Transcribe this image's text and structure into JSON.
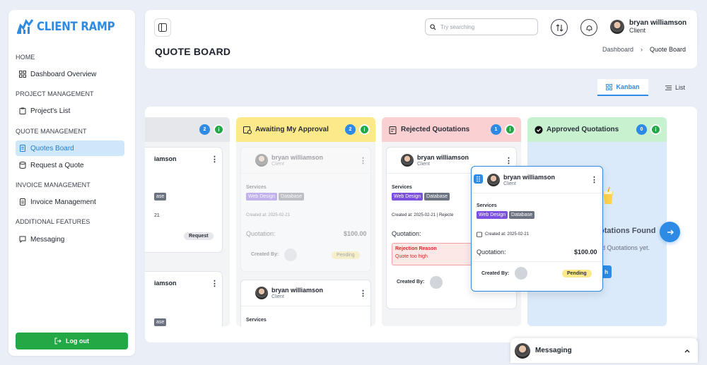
{
  "app": {
    "name": "CLIENT RAMP"
  },
  "sidebar": {
    "sections": [
      {
        "label": "HOME",
        "items": [
          {
            "label": "Dashboard Overview",
            "icon": "dashboard-icon"
          }
        ]
      },
      {
        "label": "PROJECT MANAGEMENT",
        "items": [
          {
            "label": "Project's List",
            "icon": "clipboard-icon"
          }
        ]
      },
      {
        "label": "QUOTE MANAGEMENT",
        "items": [
          {
            "label": "Quotes Board",
            "icon": "document-icon",
            "active": true
          },
          {
            "label": "Request a Quote",
            "icon": "database-icon"
          }
        ]
      },
      {
        "label": "INVOICE MANAGEMENT",
        "items": [
          {
            "label": "Invoice Management",
            "icon": "invoice-icon"
          }
        ]
      },
      {
        "label": "ADDITIONAL FEATURES",
        "items": [
          {
            "label": "Messaging",
            "icon": "chat-icon"
          }
        ]
      }
    ],
    "logout_label": "Log out"
  },
  "header": {
    "search_placeholder": "Try searching",
    "user": {
      "name": "bryan williamson",
      "role": "Client"
    }
  },
  "page": {
    "title": "QUOTE BOARD",
    "breadcrumb": [
      "Dashboard",
      "Quote Board"
    ]
  },
  "views": {
    "kanban": "Kanban",
    "list": "List",
    "active": "kanban"
  },
  "board": {
    "columns": [
      {
        "title": "",
        "count": "2",
        "info": "i",
        "header_color": "#e5e7eb",
        "cards": [
          {
            "name": "iamson",
            "tag_db": "ase",
            "date_frag": "21",
            "action": "Request"
          },
          {
            "name": "iamson",
            "tag_db": "ase"
          }
        ]
      },
      {
        "title": "Awaiting My Approval",
        "count": "2",
        "info": "i",
        "header_color": "#fbe98a",
        "cards": [
          {
            "name": "bryan williamson",
            "role": "Client",
            "services_label": "Services",
            "tags": [
              "Web Design",
              "Database"
            ],
            "created_at": "Created at: 2025-02-21",
            "quotation_label": "Quotation:",
            "amount": "$100.00",
            "created_by": "Created By:",
            "status": "Pending"
          },
          {
            "name": "bryan williamson",
            "role": "Client",
            "services_label": "Services"
          }
        ]
      },
      {
        "title": "Rejected Quotations",
        "count": "1",
        "info": "i",
        "header_color": "#fbd0d2",
        "cards": [
          {
            "name": "bryan williamson",
            "role": "Client",
            "services_label": "Services",
            "tags": [
              "Web Design",
              "Database"
            ],
            "created_at": "Created at: 2025-02-21",
            "rejection_frag": "| Rejecte",
            "quotation_label": "Quotation:",
            "rejection_label": "Rejection Reason",
            "rejection_reason": "Quote too high",
            "created_by": "Created By:"
          }
        ]
      },
      {
        "title": "Approved Quotations",
        "count": "0",
        "info": "i",
        "header_color": "#c8f2cf",
        "empty_title": "otations Found",
        "empty_sub": "d Quotations yet.",
        "empty_button": "h"
      }
    ],
    "dragged_card": {
      "name": "bryan williamson",
      "role": "Client",
      "services_label": "Services",
      "tags": [
        "Web Design",
        "Database"
      ],
      "created_at": "Created at: 2025-02-21",
      "quotation_label": "Quotation:",
      "amount": "$100.00",
      "created_by": "Created By:",
      "status": "Pending"
    }
  },
  "messaging": {
    "label": "Messaging"
  },
  "colors": {
    "accent": "#2d8be6",
    "success": "#22a845",
    "tag_web": "#7b4fe0",
    "tag_db": "#6b7280",
    "pending": "#fbe98a"
  }
}
